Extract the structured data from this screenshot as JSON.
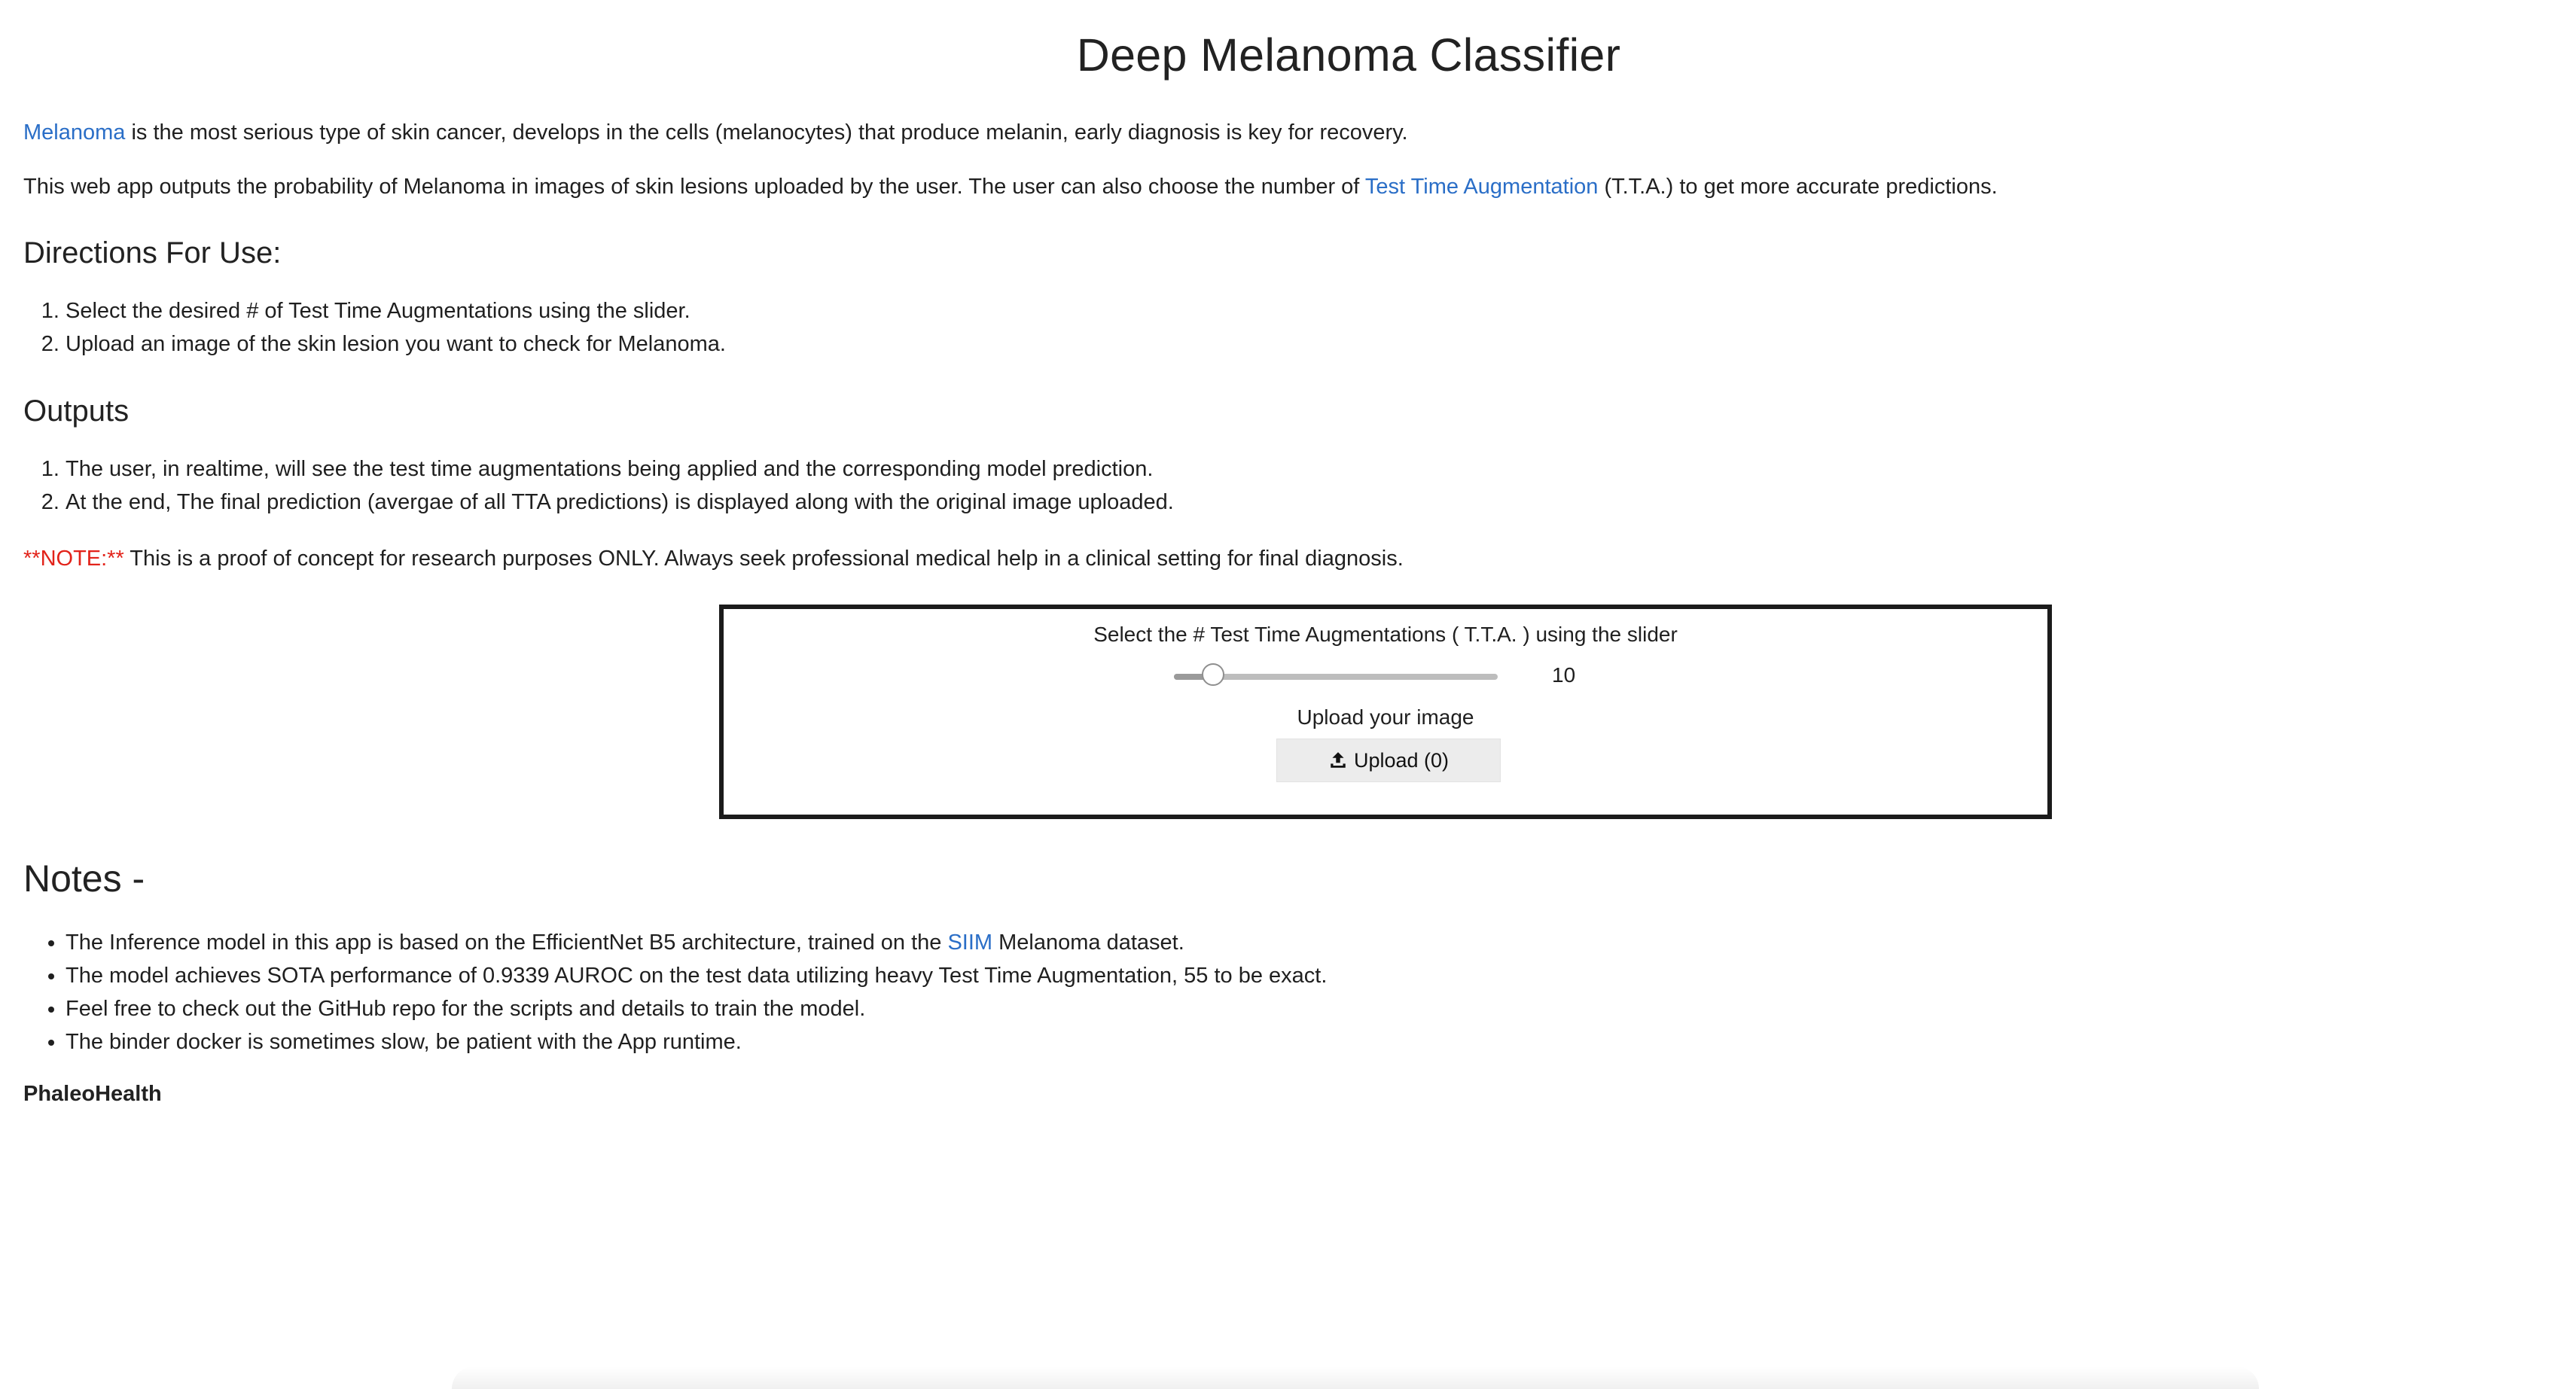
{
  "title": "Deep Melanoma Classifier",
  "intro": {
    "link": "Melanoma",
    "text": " is the most serious type of skin cancer, develops in the cells (melanocytes) that produce melanin, early diagnosis is key for recovery."
  },
  "description": {
    "before": "This web app outputs the probability of Melanoma in images of skin lesions uploaded by the user. The user can also choose the number of ",
    "link": "Test Time Augmentation",
    "after": " (T.T.A.) to get more accurate predictions."
  },
  "directions": {
    "heading": "Directions For Use:",
    "items": [
      "Select the desired # of Test Time Augmentations using the slider.",
      "Upload an image of the skin lesion you want to check for Melanoma."
    ]
  },
  "outputs": {
    "heading": "Outputs",
    "items": [
      "The user, in realtime, will see the test time augmentations being applied and the corresponding model prediction.",
      "At the end, The final prediction (avergae of all TTA predictions) is displayed along with the original image uploaded."
    ]
  },
  "note": {
    "tag": "**NOTE:**",
    "text": " This is a proof of concept for research purposes ONLY. Always seek professional medical help in a clinical setting for final diagnosis."
  },
  "widget": {
    "slider_caption": "Select the # Test Time Augmentations ( T.T.A. ) using the slider",
    "slider_value": "10",
    "slider_fraction": 0.12,
    "upload_caption": "Upload your image",
    "upload_button": "Upload (0)",
    "upload_icon": "upload-icon"
  },
  "notes": {
    "heading": "Notes -",
    "item1_before": "The Inference model in this app is based on the EfficientNet B5 architecture, trained on the ",
    "item1_link": "SIIM",
    "item1_after": " Melanoma dataset.",
    "item2": "The model achieves SOTA performance of 0.9339 AUROC on the test data utilizing heavy Test Time Augmentation, 55 to be exact.",
    "item3": "Feel free to check out the GitHub repo for the scripts and details to train the model.",
    "item4": "The binder docker is sometimes slow, be patient with the App runtime."
  },
  "footer": {
    "name": "PhaleoHealth"
  },
  "colors": {
    "link": "#2a6ec7",
    "note": "#e2231a",
    "border": "#1b1b1b",
    "button_bg": "#ececec"
  }
}
